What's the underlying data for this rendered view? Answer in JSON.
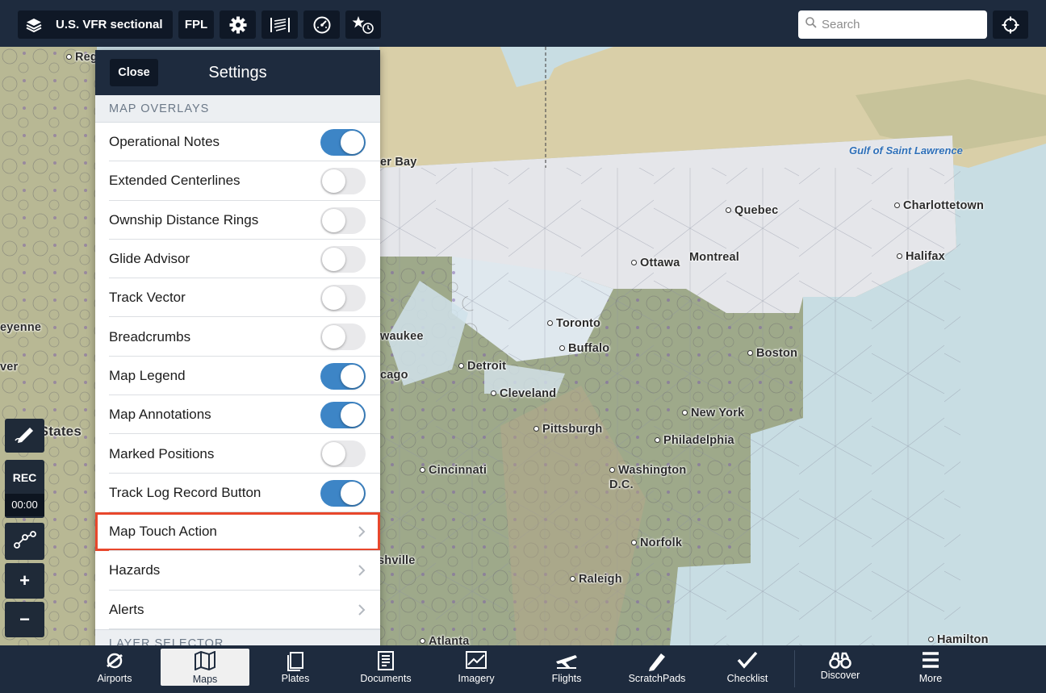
{
  "toolbar": {
    "layers_label": "U.S. VFR sectional",
    "fpl_label": "FPL",
    "search_placeholder": "Search",
    "icons": [
      "layers-icon",
      "gear-icon",
      "procedure-icon",
      "gauge-icon",
      "favorites-recent-icon",
      "locate-icon"
    ]
  },
  "map": {
    "cities": [
      "Reg",
      "er Bay",
      "Quebec",
      "Charlottetown",
      "Ottawa",
      "Montreal",
      "Halifax",
      "eyenne",
      "ver",
      "waukee",
      "Toronto",
      "Buffalo",
      "Boston",
      "Detroit",
      "cago",
      "Cleveland",
      "Unit States",
      "New York",
      "Pittsburgh",
      "Philadelphia",
      "Cincinnati",
      "Washington D.C.",
      "Norfolk",
      "shville",
      "Raleigh",
      "Atlanta",
      "Hamilton"
    ],
    "water": "Gulf of Saint Lawrence"
  },
  "left_tools": {
    "rec_label": "REC",
    "rec_time": "00:00",
    "zoom_in": "+",
    "zoom_out": "−"
  },
  "settings": {
    "close_label": "Close",
    "title": "Settings",
    "section_overlays": "MAP OVERLAYS",
    "items": [
      {
        "label": "Operational Notes",
        "type": "toggle",
        "on": true
      },
      {
        "label": "Extended Centerlines",
        "type": "toggle",
        "on": false
      },
      {
        "label": "Ownship Distance Rings",
        "type": "toggle",
        "on": false
      },
      {
        "label": "Glide Advisor",
        "type": "toggle",
        "on": false
      },
      {
        "label": "Track Vector",
        "type": "toggle",
        "on": false
      },
      {
        "label": "Breadcrumbs",
        "type": "toggle",
        "on": false
      },
      {
        "label": "Map Legend",
        "type": "toggle",
        "on": true
      },
      {
        "label": "Map Annotations",
        "type": "toggle",
        "on": true
      },
      {
        "label": "Marked Positions",
        "type": "toggle",
        "on": false
      },
      {
        "label": "Track Log Record Button",
        "type": "toggle",
        "on": true
      },
      {
        "label": "Map Touch Action",
        "type": "nav",
        "highlighted": true
      },
      {
        "label": "Hazards",
        "type": "nav"
      },
      {
        "label": "Alerts",
        "type": "nav"
      }
    ],
    "section_layers": "LAYER SELECTOR"
  },
  "tabs": [
    {
      "label": "Airports",
      "icon": "airport-icon"
    },
    {
      "label": "Maps",
      "icon": "map-icon",
      "active": true
    },
    {
      "label": "Plates",
      "icon": "plates-icon"
    },
    {
      "label": "Documents",
      "icon": "documents-icon"
    },
    {
      "label": "Imagery",
      "icon": "imagery-icon"
    },
    {
      "label": "Flights",
      "icon": "flights-icon"
    },
    {
      "label": "ScratchPads",
      "icon": "scratchpad-icon"
    },
    {
      "label": "Checklist",
      "icon": "checklist-icon"
    },
    {
      "label": "Discover",
      "icon": "discover-icon"
    },
    {
      "label": "More",
      "icon": "more-icon"
    }
  ],
  "colors": {
    "bar": "#1e2b3e",
    "button": "#0f1826",
    "toggle_on": "#3d85c6",
    "highlight": "#e8472c"
  }
}
